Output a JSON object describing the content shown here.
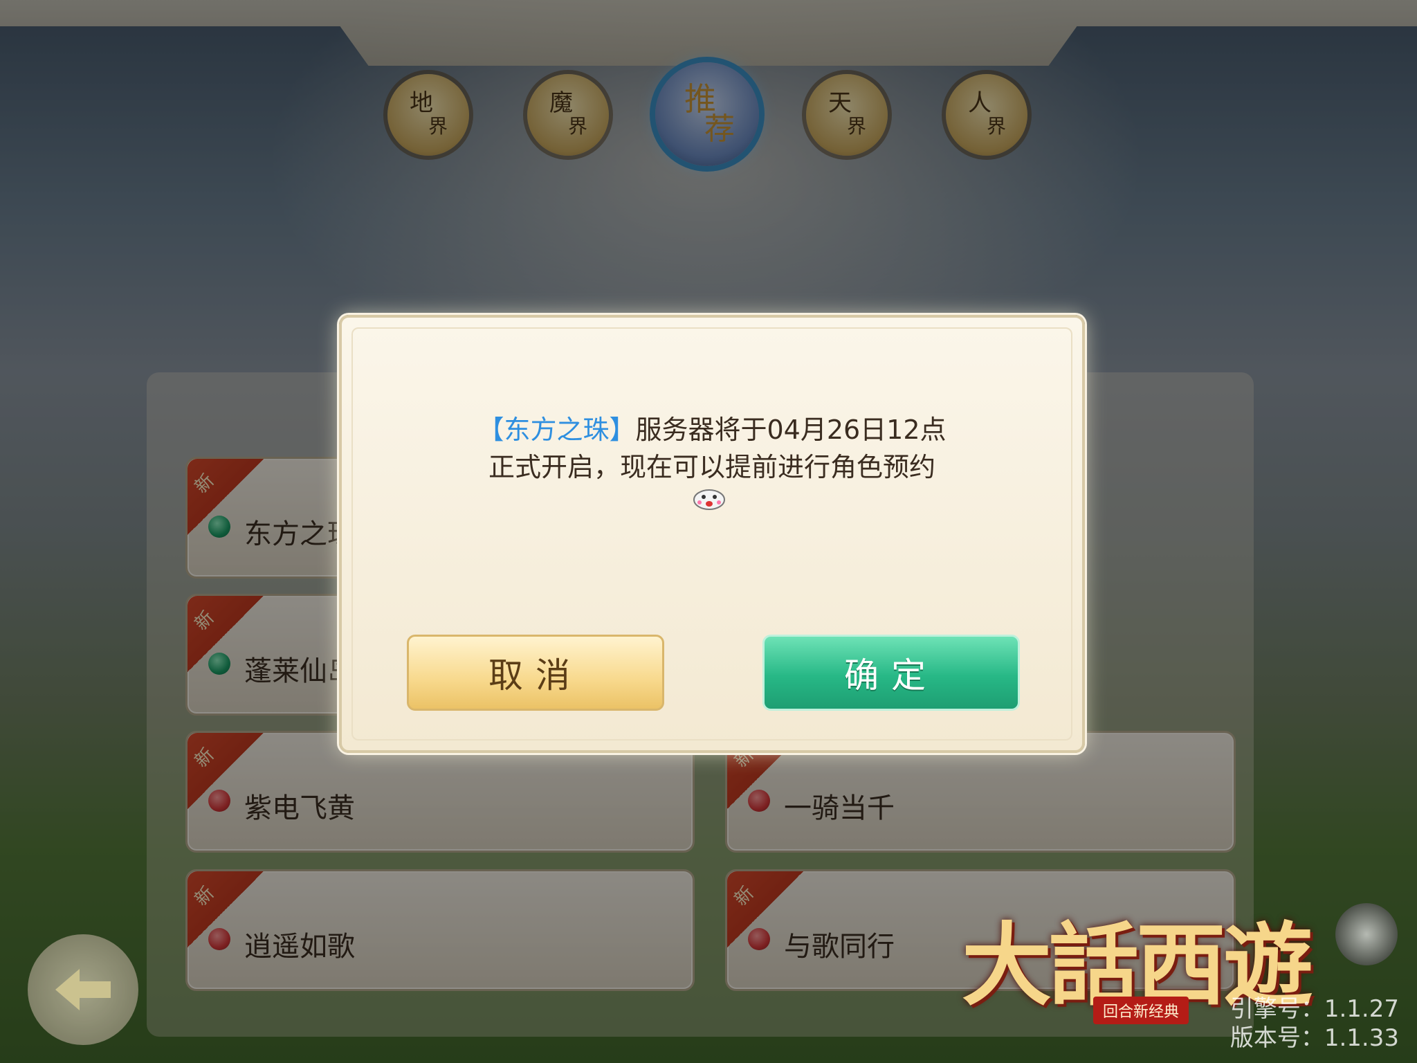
{
  "realm_tabs": [
    {
      "top": "地",
      "bottom": "界"
    },
    {
      "top": "魔",
      "bottom": "界"
    },
    {
      "top": "推",
      "bottom": "荐"
    },
    {
      "top": "天",
      "bottom": "界"
    },
    {
      "top": "人",
      "bottom": "界"
    }
  ],
  "active_tab": "推荐",
  "new_badge": "新",
  "servers": [
    {
      "name": "东方之珠",
      "status": "green"
    },
    {
      "name": "蓬莱仙岛",
      "status": "green"
    },
    {
      "name": "紫电飞黄",
      "status": "red"
    },
    {
      "name": "逍遥如歌",
      "status": "red"
    },
    {
      "name": "一骑当千",
      "status": "red"
    },
    {
      "name": "与歌同行",
      "status": "red"
    }
  ],
  "dialog": {
    "highlight": "【东方之珠】",
    "line1": "服务器将于04月26日12点",
    "line2": "正式开启，现在可以提前进行角色预约",
    "cancel": "取消",
    "confirm": "确定"
  },
  "logo": {
    "title": "大話西遊",
    "subtitle": "回合新经典"
  },
  "engine_version": "引擎号：1.1.27",
  "app_version": "版本号：1.1.33",
  "colors": {
    "highlight": "#2e8fe0",
    "confirm": "#27b886",
    "cancel": "#f8d98d",
    "online": "#1c9d66",
    "busy": "#d6383a"
  }
}
